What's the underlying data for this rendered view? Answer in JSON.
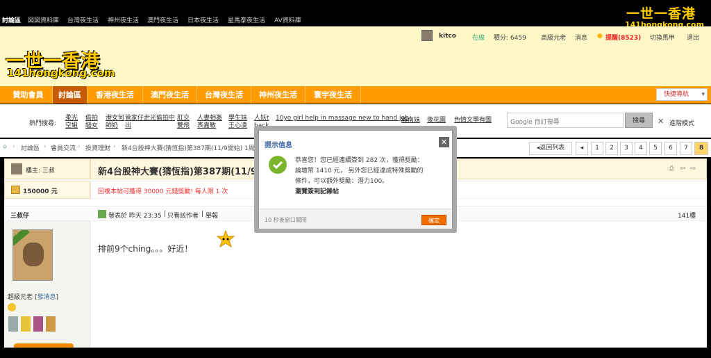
{
  "topnav": {
    "items": [
      "討論區",
      "図図資料庫",
      "台灣夜生活",
      "神州夜生活",
      "澳門夜生活",
      "日本夜生活",
      "星馬泰夜生活",
      "AV資料庫"
    ]
  },
  "site_logo": {
    "cn": "一世一香港",
    "en": "141hongkong.com"
  },
  "user_bar": {
    "username": "kitco",
    "online": "在線",
    "points": "積分: 6459",
    "rank": "高級元老",
    "messages": "消息",
    "reminders": "提醒(8523)",
    "switch": "切換馬甲",
    "logout": "退出"
  },
  "mainnav": {
    "items": [
      "贊助會員",
      "討論區",
      "香港夜生活",
      "澳門夜生活",
      "台灣夜生活",
      "神州夜生活",
      "寰宇夜生活"
    ],
    "quick_nav": "快捷導航"
  },
  "hot_search": {
    "label": "熱門搜尋:",
    "keywords": [
      "柔光空姐",
      "偷拍騷女",
      "港女何師奶",
      "管家仔走光偷拍中出",
      "肛交雙飛",
      "人妻相姦表嘉敏",
      "學生妹王心凌",
      "人妖t back",
      "10yo girl help in massage new to hand job",
      "越南妹",
      "後花園",
      "色情文學有圖"
    ],
    "search_placeholder": "Google 自訂搜尋",
    "search_button": "搜尋",
    "advanced": "進階模式"
  },
  "breadcrumb": {
    "items": [
      "討論區",
      "會員交流",
      "投資理財",
      "新4台股神大賽(猜恆指)第387期(11/9開始) 1周賽"
    ],
    "back_label": "返回列表",
    "pages": [
      "1",
      "2",
      "3",
      "4",
      "5",
      "6",
      "7",
      "8"
    ],
    "current_page": "8"
  },
  "thread": {
    "owner_label": "樓主: 三叔",
    "title": "新4台股神大賽(猜恆指)第387期(11/9開始",
    "coins": "150000 元",
    "reward_text": "回複本帖可獲得 30000 元錢獎勵! 每人限 1 次",
    "post_author": "三叔仔",
    "post_meta_time": "發表於 昨天 23:35",
    "only_author": "只看該作者",
    "report": "舉報",
    "floor": "141樓",
    "post_body": "排前9个ching。。。好近！",
    "user_group": "超級元老",
    "send_msg": "發消息"
  },
  "modal": {
    "title": "提示信息",
    "message_line1": "恭喜您！您已經連續簽到 282 次，獲得獎勵：",
    "message_line2": "論壇幣 1410 元， 另外您已經達成特殊獎勵的",
    "message_line3": "條件，可以額外獎勵：潛力100。",
    "link": "瀏覽簽到記錄帖",
    "footer_text": "10 秒後窗口關閉",
    "ok_button": "確定"
  },
  "colors": {
    "nav_orange": "#ff9c00",
    "header_bg": "#fef7c6",
    "reward_red": "#e33333",
    "modal_title": "#3863a6",
    "ok_orange": "#f06c00"
  }
}
